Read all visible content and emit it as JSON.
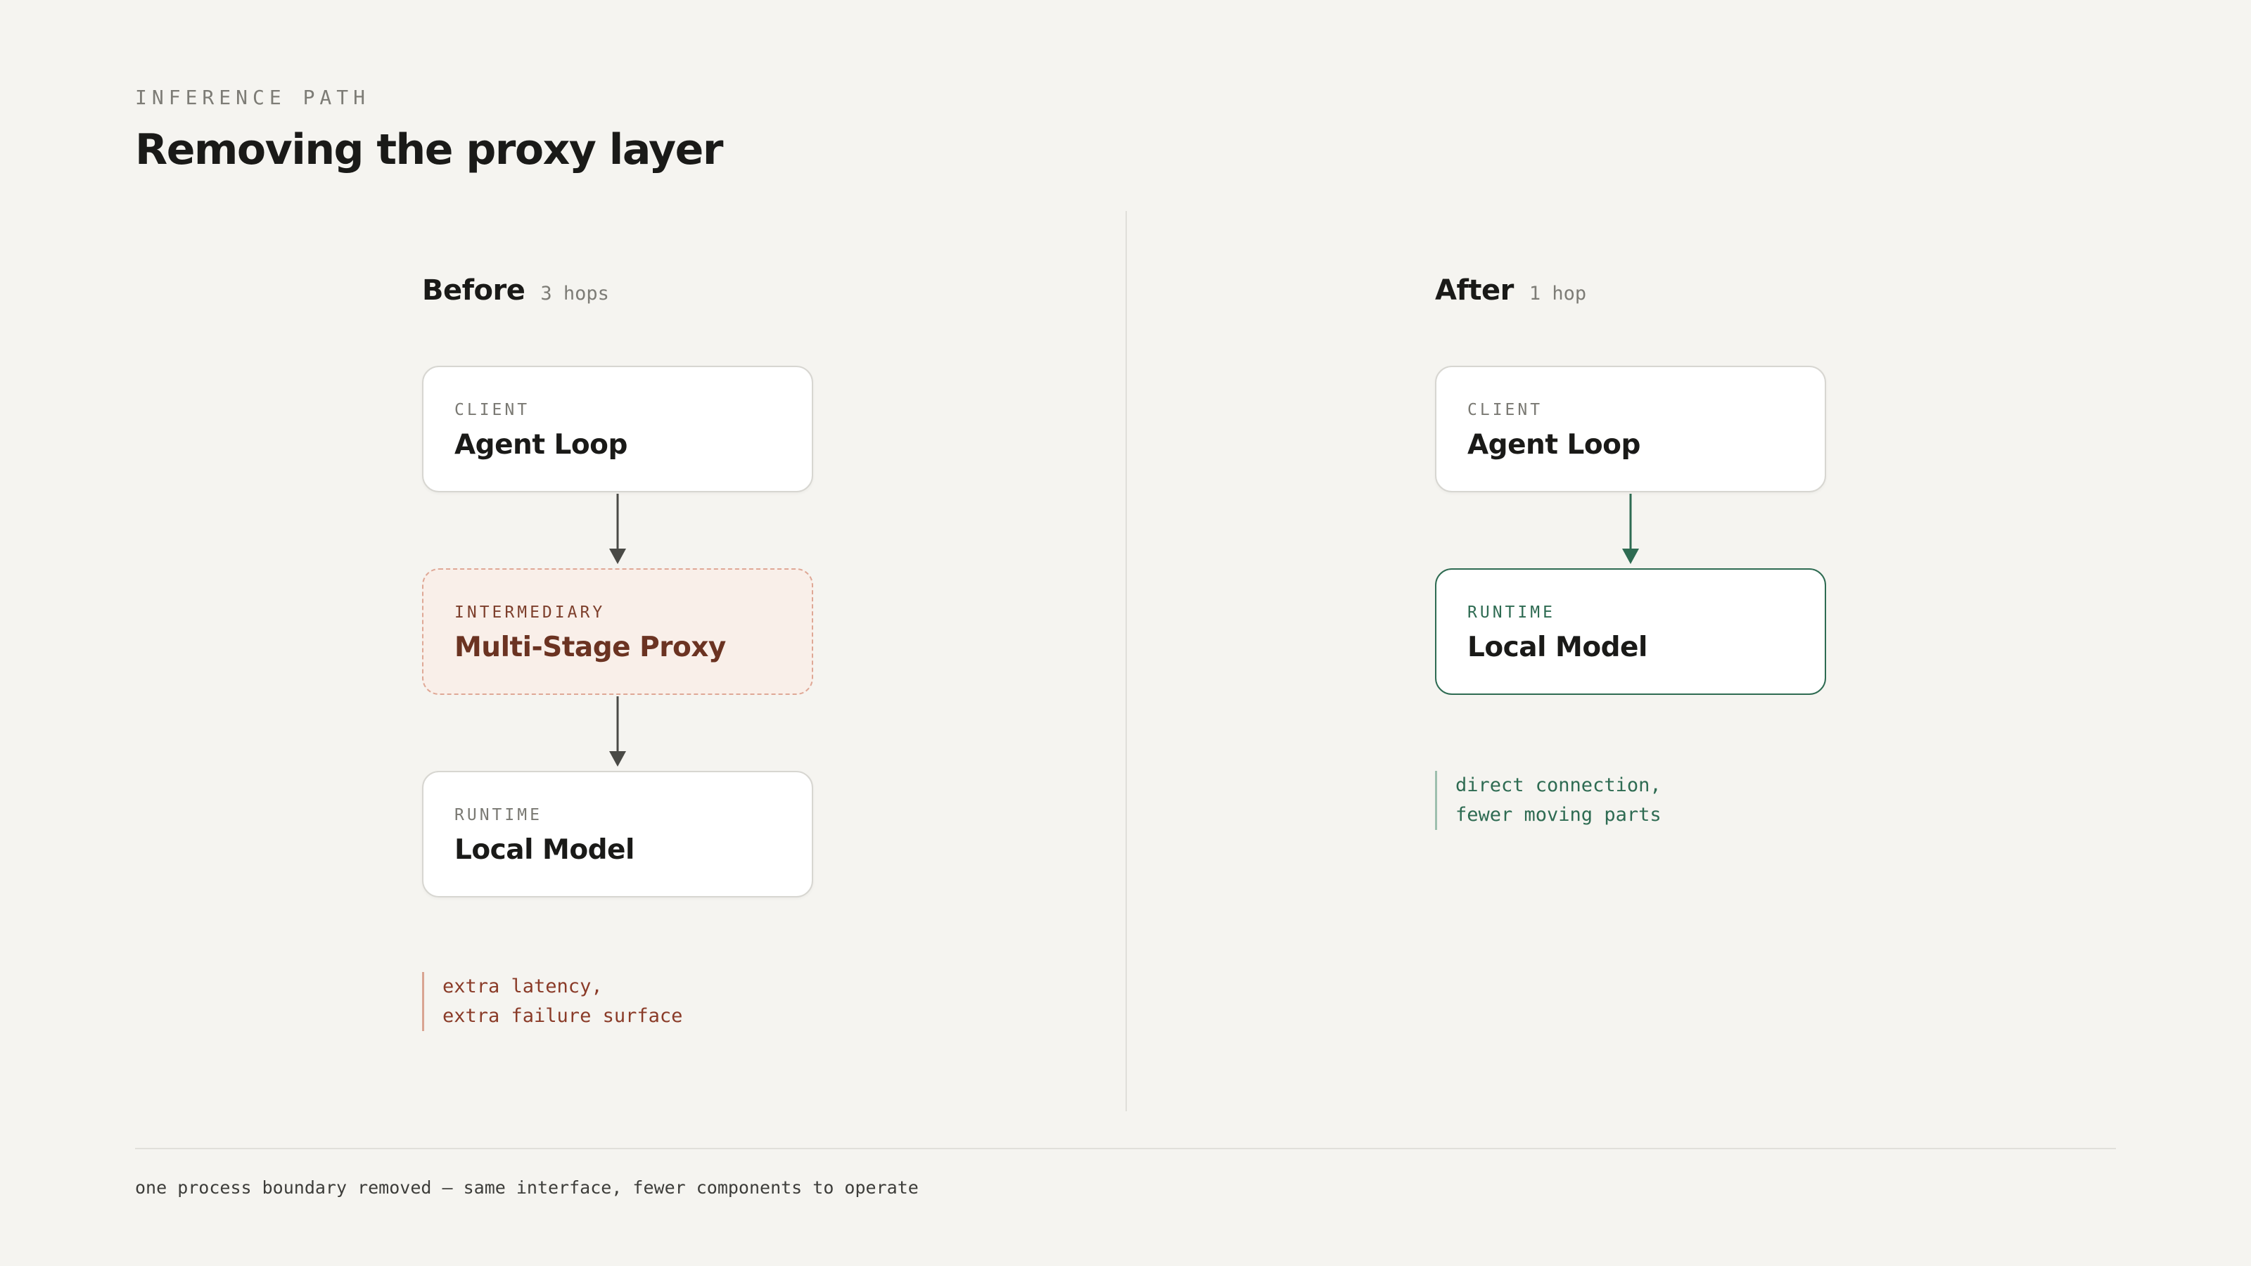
{
  "header": {
    "eyebrow": "INFERENCE PATH",
    "title": "Removing the proxy layer"
  },
  "before": {
    "title": "Before",
    "hops": "3 hops",
    "nodes": [
      {
        "kind": "CLIENT",
        "name": "Agent Loop"
      },
      {
        "kind": "INTERMEDIARY",
        "name": "Multi-Stage Proxy"
      },
      {
        "kind": "RUNTIME",
        "name": "Local Model"
      }
    ],
    "note": [
      "extra latency,",
      "extra failure surface"
    ]
  },
  "after": {
    "title": "After",
    "hops": "1 hop",
    "nodes": [
      {
        "kind": "CLIENT",
        "name": "Agent Loop"
      },
      {
        "kind": "RUNTIME",
        "name": "Local Model"
      }
    ],
    "note": [
      "direct connection,",
      "fewer moving parts"
    ]
  },
  "footer": "one process boundary removed — same interface, fewer components to operate",
  "colors": {
    "background": "#f5f4f0",
    "text": "#1a1a18",
    "muted": "#7d7c76",
    "proxy_fill": "#f9efe9",
    "proxy_border": "#dfa896",
    "proxy_text": "#6b3322",
    "accent_green": "#2e6b52",
    "arrow_dark": "#4a4a46"
  }
}
